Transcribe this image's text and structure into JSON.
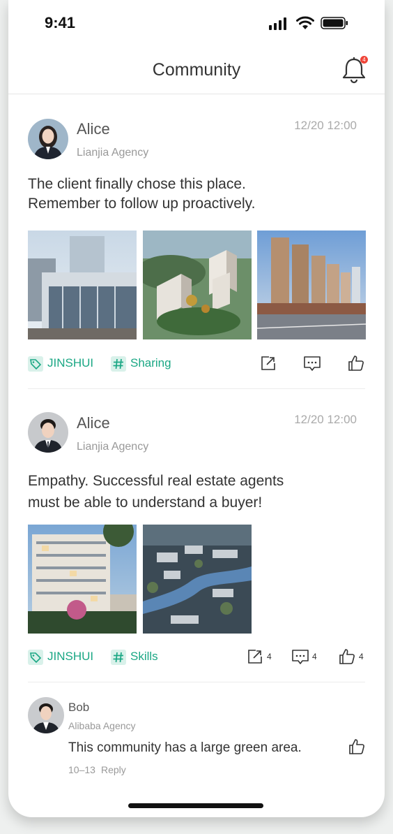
{
  "status_bar": {
    "time": "9:41"
  },
  "header": {
    "title": "Community",
    "notification_count": "4"
  },
  "posts": [
    {
      "author": "Alice",
      "agency": "Lianjia Agency",
      "date": "12/20 12:00",
      "text_lines": [
        "The client finally chose this place.",
        "Remember to follow up proactively."
      ],
      "tags": [
        "JINSHUI",
        "Sharing"
      ],
      "share_count": "",
      "comment_count": "",
      "like_count": ""
    },
    {
      "author": "Alice",
      "agency": "Lianjia Agency",
      "date": "12/20 12:00",
      "text_lines": [
        "Empathy. Successful real estate agents",
        "must be able to understand a buyer!"
      ],
      "tags": [
        "JINSHUI",
        "Skills"
      ],
      "share_count": "4",
      "comment_count": "4",
      "like_count": "4"
    }
  ],
  "comment": {
    "author": "Bob",
    "agency": "Alibaba Agency",
    "text": "This community has a large green area.",
    "date": "10–13",
    "reply_label": "Reply"
  },
  "colors": {
    "accent": "#1aa784",
    "tag_bg": "#d9f1ea",
    "badge": "#f04438"
  },
  "icons": [
    "bell-icon",
    "tag-icon",
    "hashtag-icon",
    "share-icon",
    "comment-icon",
    "like-icon"
  ]
}
